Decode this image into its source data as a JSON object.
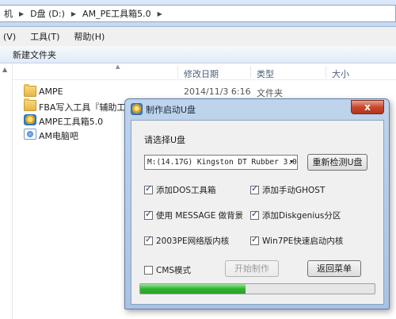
{
  "explorer": {
    "breadcrumbs": [
      "机",
      "D盘 (D:)",
      "AM_PE工具箱5.0"
    ],
    "menus": [
      "(V)",
      "工具(T)",
      "帮助(H)"
    ],
    "toolbar": {
      "new_folder": "新建文件夹"
    },
    "columns": {
      "modified": "修改日期",
      "type": "类型",
      "size": "大小"
    },
    "files": [
      {
        "name": "AMPE",
        "date": "2014/11/3 6:16",
        "type": "文件夹",
        "icon": "folder-icon"
      },
      {
        "name": "FBA写入工具『辅助工具』",
        "date": "",
        "type": "",
        "icon": "folder-icon"
      },
      {
        "name": "AMPE工具箱5.0",
        "date": "",
        "type": "",
        "icon": "app-icon"
      },
      {
        "name": "AM电脑吧",
        "date": "",
        "type": "",
        "icon": "web-shortcut-icon"
      }
    ]
  },
  "dialog": {
    "title": "制作启动U盘",
    "close_label": "x",
    "select_label": "请选择U盘",
    "usb_device": "M:(14.17G) Kingston DT Rubber 3.0",
    "redetect_label": "重新检测U盘",
    "options": [
      {
        "label": "添加DOS工具箱",
        "checked": true
      },
      {
        "label": "添加手动GHOST",
        "checked": true
      },
      {
        "label": "使用 MESSAGE 做背景",
        "checked": true
      },
      {
        "label": "添加Diskgenius分区",
        "checked": true
      },
      {
        "label": "2003PE网络版内核",
        "checked": true
      },
      {
        "label": "Win7PE快速启动内核",
        "checked": true
      }
    ],
    "cms_mode": {
      "label": "CMS模式",
      "checked": false
    },
    "start_label": "开始制作",
    "back_label": "返回菜单",
    "progress": 0.45,
    "colors": {
      "progress": "#2fb22f",
      "close": "#c9472d"
    }
  }
}
